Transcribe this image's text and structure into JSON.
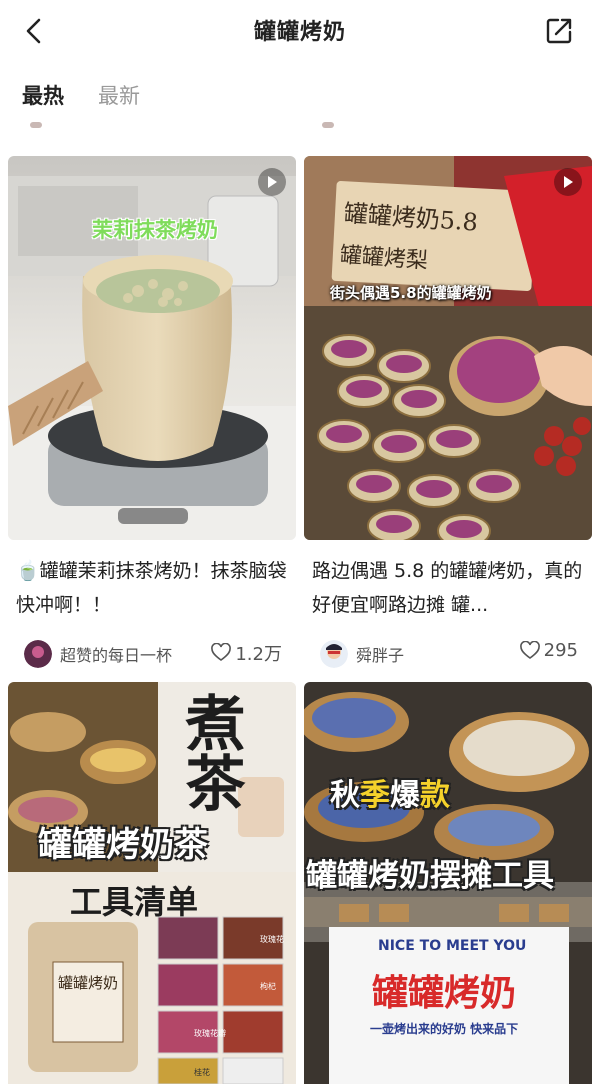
{
  "header": {
    "title": "罐罐烤奶"
  },
  "tabs": [
    {
      "label": "最热",
      "active": true
    },
    {
      "label": "最新",
      "active": false
    }
  ],
  "cards": [
    {
      "overlay": "茉莉抹茶烤奶",
      "title_emoji": "🍵",
      "title": "罐罐茉莉抹茶烤奶！抹茶脑袋快冲啊！！",
      "author": "超赞的每日一杯",
      "likes": "1.2万"
    },
    {
      "sign_text": "罐罐烤奶5.8",
      "sign_text2": "罐罐烤梨",
      "overlay": "街头偶遇5.8的罐罐烤奶",
      "title": "路边偶遇 5.8 的罐罐烤奶，真的好便宜啊路边摊 罐...",
      "author": "舜胖子",
      "likes": "295"
    },
    {
      "overlay1": "罐罐烤奶茶",
      "overlay2": "工具清单",
      "cup_text": "罐罐烤奶",
      "brush_text": "煮茶",
      "label1": "玫瑰花",
      "label2": "枸杞",
      "label3": "玫瑰花瓣",
      "label4": "桂花"
    },
    {
      "overlay1_a": "秋",
      "overlay1_b": "季",
      "overlay1_c": "爆",
      "overlay1_d": "款",
      "overlay2": "罐罐烤奶摆摊工具",
      "banner_en": "NICE TO MEET YOU",
      "banner_cn": "罐罐烤奶",
      "banner_sub": "一壶烤出来的好奶 快来品下"
    }
  ],
  "colors": {
    "accent_red": "#d82a2a",
    "muted": "#9a9a9a"
  },
  "icons": [
    "back-icon",
    "share-icon",
    "play-icon",
    "heart-icon"
  ]
}
